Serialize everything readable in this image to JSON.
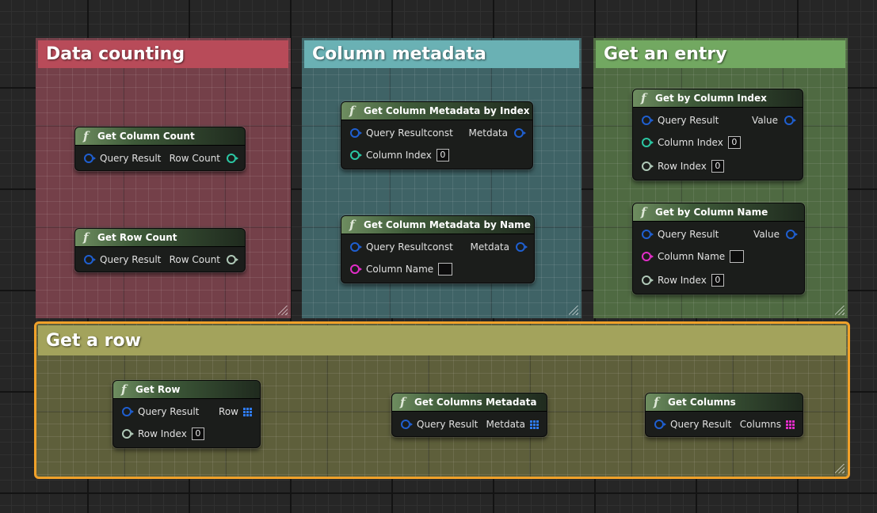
{
  "comments": {
    "data_counting": "Data counting",
    "column_metadata": "Column metadata",
    "get_an_entry": "Get an entry",
    "get_a_row": "Get a row"
  },
  "colors": {
    "data_counting": "#b84b59",
    "column_metadata": "#6ab1b4",
    "get_an_entry": "#72a861",
    "get_a_row": "#a3a35c",
    "selection_outline": "#f0a12a",
    "pin_struct": "#1f5fd0",
    "pin_int": "#2bc7a3",
    "pin_name": "#e22dc8"
  },
  "icons": {
    "function": "f",
    "function_icon_name": "function-icon",
    "array_icon_name": "array-grid-icon"
  },
  "nodes": {
    "get_column_count": {
      "title": "Get Column Count",
      "in_label": "Query Result",
      "out_label": "Row Count"
    },
    "get_row_count": {
      "title": "Get Row Count",
      "in_label": "Query Result",
      "out_label": "Row Count"
    },
    "get_col_meta_by_index": {
      "title": "Get Column Metadata by Index",
      "in_label": "Query Resultconst",
      "out_label": "Metdata",
      "index_label": "Column Index",
      "index_value": "0"
    },
    "get_col_meta_by_name": {
      "title": "Get Column Metadata by Name",
      "in_label": "Query Resultconst",
      "out_label": "Metdata",
      "name_label": "Column Name",
      "name_value": ""
    },
    "get_by_column_index": {
      "title": "Get by Column Index",
      "in_label": "Query Result",
      "out_label": "Value",
      "col_label": "Column Index",
      "col_value": "0",
      "row_label": "Row Index",
      "row_value": "0"
    },
    "get_by_column_name": {
      "title": "Get by Column Name",
      "in_label": "Query Result",
      "out_label": "Value",
      "col_label": "Column Name",
      "col_value": "",
      "row_label": "Row Index",
      "row_value": "0"
    },
    "get_row": {
      "title": "Get Row",
      "in_label": "Query Result",
      "out_label": "Row",
      "row_label": "Row Index",
      "row_value": "0"
    },
    "get_columns_metadata": {
      "title": "Get Columns Metadata",
      "in_label": "Query Result",
      "out_label": "Metdata"
    },
    "get_columns": {
      "title": "Get Columns",
      "in_label": "Query Result",
      "out_label": "Columns"
    }
  }
}
